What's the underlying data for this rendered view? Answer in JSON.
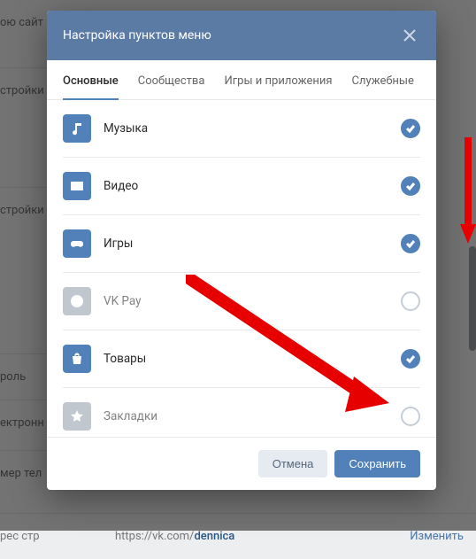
{
  "background": {
    "rows": [
      {
        "label": "ою сайт"
      },
      {
        "label": "стройки"
      },
      {
        "label": "стройки"
      },
      {
        "label": "роль"
      },
      {
        "label": "ектронн"
      },
      {
        "label": "мер тел"
      },
      {
        "label": "рес стр"
      }
    ],
    "url_prefix": "https://vk.com/",
    "url_slug": "dennica",
    "change_label": "Изменить"
  },
  "modal": {
    "title": "Настройка пунктов меню",
    "tabs": [
      {
        "label": "Основные",
        "active": true
      },
      {
        "label": "Сообщества",
        "active": false
      },
      {
        "label": "Игры и приложения",
        "active": false
      },
      {
        "label": "Служебные",
        "active": false
      }
    ],
    "items": [
      {
        "id": "music",
        "label": "Музыка",
        "checked": true,
        "icon": "music",
        "enabled": true
      },
      {
        "id": "video",
        "label": "Видео",
        "checked": true,
        "icon": "video",
        "enabled": true
      },
      {
        "id": "games",
        "label": "Игры",
        "checked": true,
        "icon": "gamepad",
        "enabled": true
      },
      {
        "id": "vkpay",
        "label": "VK Pay",
        "checked": false,
        "icon": "ruble",
        "enabled": false
      },
      {
        "id": "market",
        "label": "Товары",
        "checked": true,
        "icon": "bag",
        "enabled": true
      },
      {
        "id": "bookmarks",
        "label": "Закладки",
        "checked": false,
        "icon": "star",
        "enabled": false
      }
    ],
    "footer": {
      "cancel": "Отмена",
      "save": "Сохранить"
    }
  }
}
